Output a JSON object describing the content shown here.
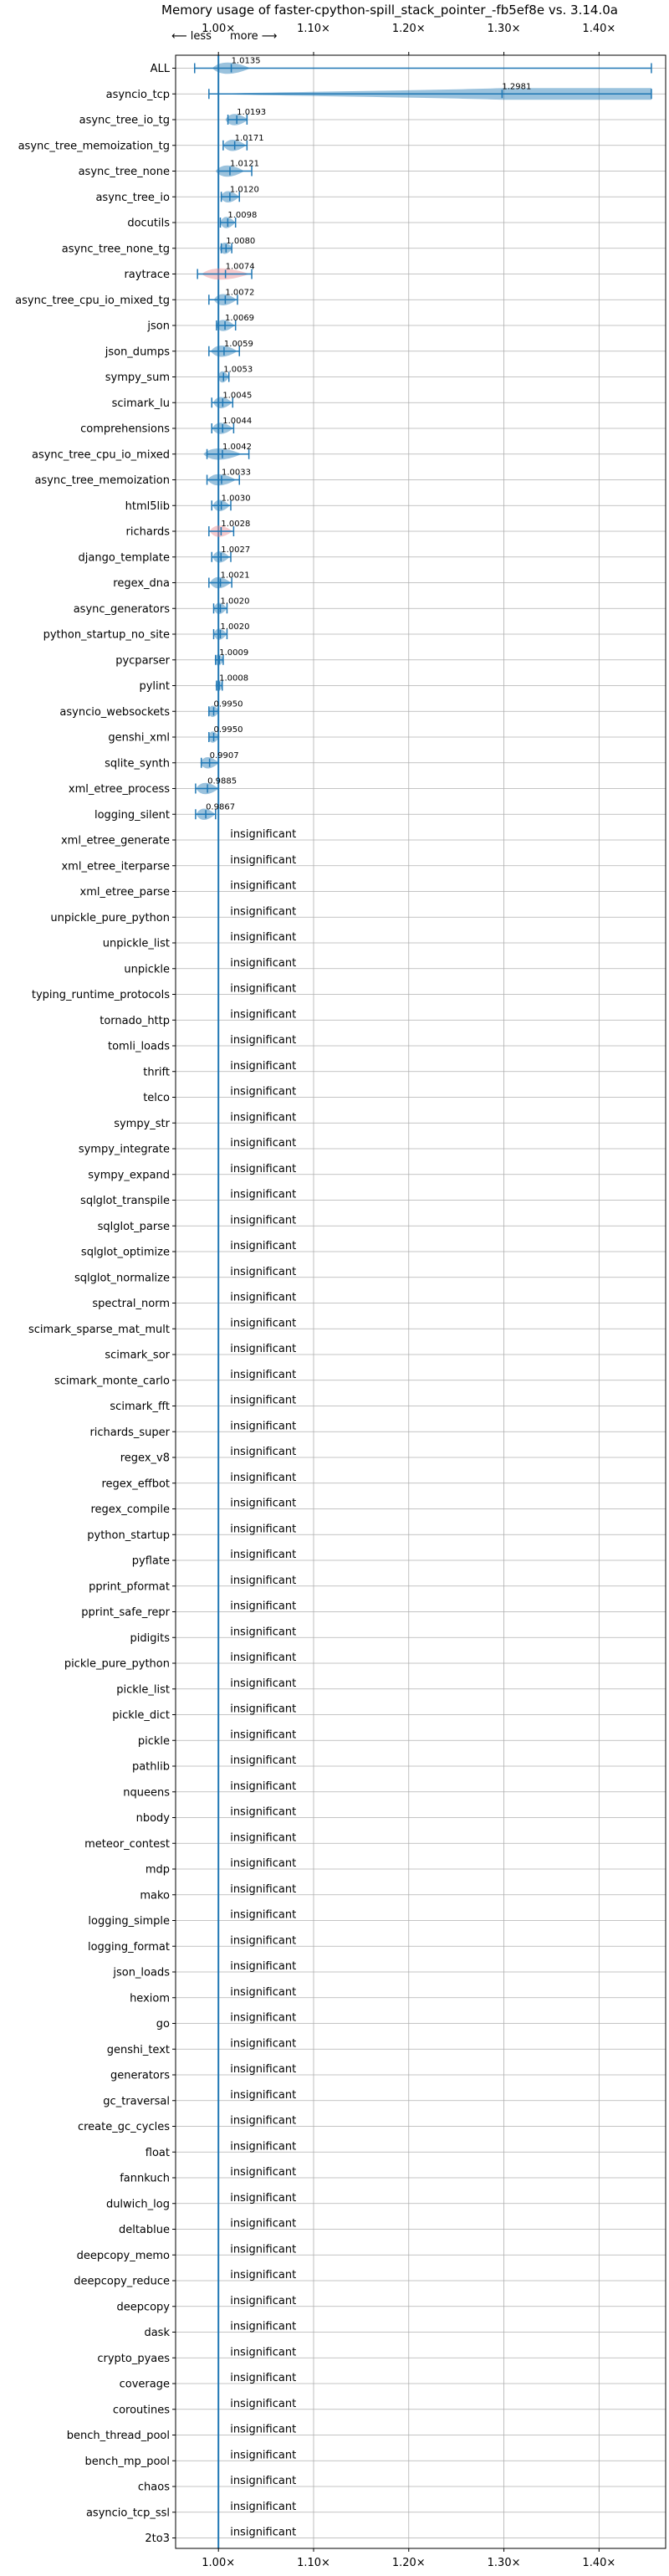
{
  "chart_data": {
    "type": "violin",
    "title": "Memory usage of faster-cpython-spill_stack_pointer_-fb5ef8e vs. 3.14.0a",
    "direction_less": "⟵ less",
    "direction_more": "more ⟶",
    "xlim": [
      0.955,
      1.47
    ],
    "x_ticks": [
      1.0,
      1.1,
      1.2,
      1.3,
      1.4
    ],
    "x_tick_labels": [
      "1.00×",
      "1.10×",
      "1.20×",
      "1.30×",
      "1.40×"
    ],
    "grid": true,
    "colors": {
      "violin": "#1f77b4",
      "violin_highlight": "#e8878f",
      "line": "#1f77b4",
      "grid": "#b0b0b0"
    },
    "significant": [
      {
        "name": "ALL",
        "mean": 1.0135,
        "label": "1.0135",
        "min": 0.975,
        "max": 1.455,
        "spread": 0.02
      },
      {
        "name": "asyncio_tcp",
        "mean": 1.2981,
        "label": "1.2981",
        "min": 0.99,
        "max": 1.455,
        "spread": 0.2,
        "wide": true
      },
      {
        "name": "async_tree_io_tg",
        "mean": 1.0193,
        "label": "1.0193",
        "min": 1.01,
        "max": 1.03,
        "spread": 0.012
      },
      {
        "name": "async_tree_memoization_tg",
        "mean": 1.0171,
        "label": "1.0171",
        "min": 1.005,
        "max": 1.03,
        "spread": 0.012
      },
      {
        "name": "async_tree_none",
        "mean": 1.0121,
        "label": "1.0121",
        "min": 1.0,
        "max": 1.035,
        "spread": 0.015
      },
      {
        "name": "async_tree_io",
        "mean": 1.012,
        "label": "1.0120",
        "min": 1.003,
        "max": 1.022,
        "spread": 0.01
      },
      {
        "name": "docutils",
        "mean": 1.0098,
        "label": "1.0098",
        "min": 1.002,
        "max": 1.018,
        "spread": 0.008
      },
      {
        "name": "async_tree_none_tg",
        "mean": 1.008,
        "label": "1.0080",
        "min": 1.003,
        "max": 1.014,
        "spread": 0.007
      },
      {
        "name": "raytrace",
        "mean": 1.0074,
        "label": "1.0074",
        "min": 0.978,
        "max": 1.035,
        "spread": 0.025,
        "highlight": true
      },
      {
        "name": "async_tree_cpu_io_mixed_tg",
        "mean": 1.0072,
        "label": "1.0072",
        "min": 0.99,
        "max": 1.02,
        "spread": 0.012
      },
      {
        "name": "json",
        "mean": 1.0069,
        "label": "1.0069",
        "min": 0.998,
        "max": 1.018,
        "spread": 0.01
      },
      {
        "name": "json_dumps",
        "mean": 1.0059,
        "label": "1.0059",
        "min": 0.99,
        "max": 1.022,
        "spread": 0.014
      },
      {
        "name": "sympy_sum",
        "mean": 1.0053,
        "label": "1.0053",
        "min": 1.0,
        "max": 1.011,
        "spread": 0.006
      },
      {
        "name": "scimark_lu",
        "mean": 1.0045,
        "label": "1.0045",
        "min": 0.993,
        "max": 1.015,
        "spread": 0.01
      },
      {
        "name": "comprehensions",
        "mean": 1.0044,
        "label": "1.0044",
        "min": 0.993,
        "max": 1.016,
        "spread": 0.011
      },
      {
        "name": "async_tree_cpu_io_mixed",
        "mean": 1.0042,
        "label": "1.0042",
        "min": 0.988,
        "max": 1.032,
        "spread": 0.02
      },
      {
        "name": "async_tree_memoization",
        "mean": 1.0033,
        "label": "1.0033",
        "min": 0.988,
        "max": 1.022,
        "spread": 0.015
      },
      {
        "name": "html5lib",
        "mean": 1.003,
        "label": "1.0030",
        "min": 0.993,
        "max": 1.013,
        "spread": 0.009
      },
      {
        "name": "richards",
        "mean": 1.0028,
        "label": "1.0028",
        "min": 0.99,
        "max": 1.016,
        "spread": 0.012,
        "highlight": true
      },
      {
        "name": "django_template",
        "mean": 1.0027,
        "label": "1.0027",
        "min": 0.993,
        "max": 1.013,
        "spread": 0.009
      },
      {
        "name": "regex_dna",
        "mean": 1.0021,
        "label": "1.0021",
        "min": 0.99,
        "max": 1.014,
        "spread": 0.011
      },
      {
        "name": "async_generators",
        "mean": 1.002,
        "label": "1.0020",
        "min": 0.995,
        "max": 1.009,
        "spread": 0.007
      },
      {
        "name": "python_startup_no_site",
        "mean": 1.002,
        "label": "1.0020",
        "min": 0.995,
        "max": 1.009,
        "spread": 0.007
      },
      {
        "name": "pycparser",
        "mean": 1.0009,
        "label": "1.0009",
        "min": 0.997,
        "max": 1.005,
        "spread": 0.005
      },
      {
        "name": "pylint",
        "mean": 1.0008,
        "label": "1.0008",
        "min": 0.998,
        "max": 1.004,
        "spread": 0.004
      },
      {
        "name": "asyncio_websockets",
        "mean": 0.995,
        "label": "0.9950",
        "min": 0.99,
        "max": 1.0,
        "spread": 0.006
      },
      {
        "name": "genshi_xml",
        "mean": 0.995,
        "label": "0.9950",
        "min": 0.99,
        "max": 1.0,
        "spread": 0.006
      },
      {
        "name": "sqlite_synth",
        "mean": 0.9907,
        "label": "0.9907",
        "min": 0.982,
        "max": 1.0,
        "spread": 0.01
      },
      {
        "name": "xml_etree_process",
        "mean": 0.9885,
        "label": "0.9885",
        "min": 0.976,
        "max": 1.0,
        "spread": 0.012
      },
      {
        "name": "logging_silent",
        "mean": 0.9867,
        "label": "0.9867",
        "min": 0.976,
        "max": 0.997,
        "spread": 0.01
      }
    ],
    "insignificant_label": "insignificant",
    "insignificant": [
      "xml_etree_generate",
      "xml_etree_iterparse",
      "xml_etree_parse",
      "unpickle_pure_python",
      "unpickle_list",
      "unpickle",
      "typing_runtime_protocols",
      "tornado_http",
      "tomli_loads",
      "thrift",
      "telco",
      "sympy_str",
      "sympy_integrate",
      "sympy_expand",
      "sqlglot_transpile",
      "sqlglot_parse",
      "sqlglot_optimize",
      "sqlglot_normalize",
      "spectral_norm",
      "scimark_sparse_mat_mult",
      "scimark_sor",
      "scimark_monte_carlo",
      "scimark_fft",
      "richards_super",
      "regex_v8",
      "regex_effbot",
      "regex_compile",
      "python_startup",
      "pyflate",
      "pprint_pformat",
      "pprint_safe_repr",
      "pidigits",
      "pickle_pure_python",
      "pickle_list",
      "pickle_dict",
      "pickle",
      "pathlib",
      "nqueens",
      "nbody",
      "meteor_contest",
      "mdp",
      "mako",
      "logging_simple",
      "logging_format",
      "json_loads",
      "hexiom",
      "go",
      "genshi_text",
      "generators",
      "gc_traversal",
      "create_gc_cycles",
      "float",
      "fannkuch",
      "dulwich_log",
      "deltablue",
      "deepcopy_memo",
      "deepcopy_reduce",
      "deepcopy",
      "dask",
      "crypto_pyaes",
      "coverage",
      "coroutines",
      "bench_thread_pool",
      "bench_mp_pool",
      "chaos",
      "asyncio_tcp_ssl",
      "2to3"
    ]
  }
}
